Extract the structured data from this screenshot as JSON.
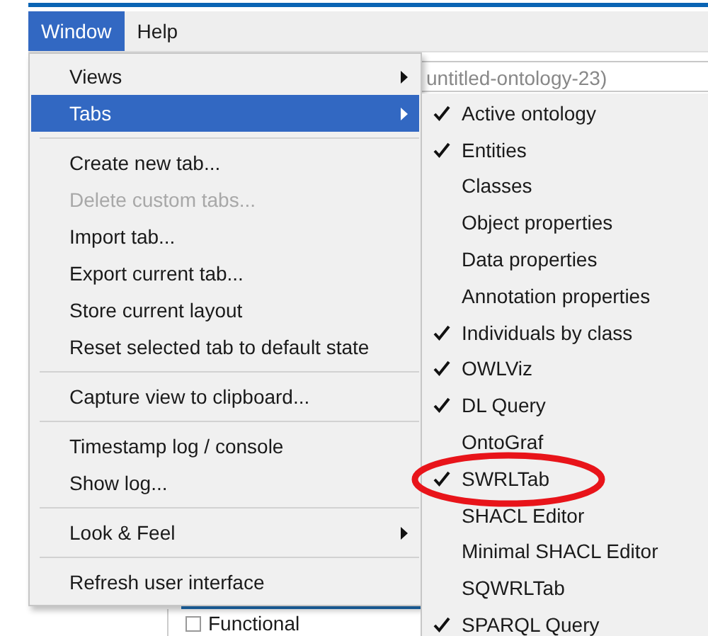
{
  "menubar": [
    {
      "label": "Window",
      "selected": true
    },
    {
      "label": "Help",
      "selected": false
    }
  ],
  "background": {
    "field_text": "untitled-ontology-23)",
    "checkbox_label": "Functional",
    "checkbox_checked": false
  },
  "window_menu": [
    {
      "kind": "item",
      "label": "Views",
      "submenu": true,
      "disabled": false,
      "selected": false
    },
    {
      "kind": "item",
      "label": "Tabs",
      "submenu": true,
      "disabled": false,
      "selected": true
    },
    {
      "kind": "separator"
    },
    {
      "kind": "item",
      "label": "Create new tab...",
      "submenu": false,
      "disabled": false,
      "selected": false
    },
    {
      "kind": "item",
      "label": "Delete custom tabs...",
      "submenu": false,
      "disabled": true,
      "selected": false
    },
    {
      "kind": "item",
      "label": "Import tab...",
      "submenu": false,
      "disabled": false,
      "selected": false
    },
    {
      "kind": "item",
      "label": "Export current tab...",
      "submenu": false,
      "disabled": false,
      "selected": false
    },
    {
      "kind": "item",
      "label": "Store current layout",
      "submenu": false,
      "disabled": false,
      "selected": false
    },
    {
      "kind": "item",
      "label": "Reset selected tab to default state",
      "submenu": false,
      "disabled": false,
      "selected": false
    },
    {
      "kind": "separator"
    },
    {
      "kind": "item",
      "label": "Capture view to clipboard...",
      "submenu": false,
      "disabled": false,
      "selected": false
    },
    {
      "kind": "separator"
    },
    {
      "kind": "item",
      "label": "Timestamp log / console",
      "submenu": false,
      "disabled": false,
      "selected": false
    },
    {
      "kind": "item",
      "label": "Show log...",
      "submenu": false,
      "disabled": false,
      "selected": false
    },
    {
      "kind": "separator"
    },
    {
      "kind": "item",
      "label": "Look & Feel",
      "submenu": true,
      "disabled": false,
      "selected": false
    },
    {
      "kind": "separator"
    },
    {
      "kind": "item",
      "label": "Refresh user interface",
      "submenu": false,
      "disabled": false,
      "selected": false
    }
  ],
  "tabs_submenu": [
    {
      "label": "Active ontology",
      "checked": true
    },
    {
      "label": "Entities",
      "checked": true
    },
    {
      "label": "Classes",
      "checked": false
    },
    {
      "label": "Object properties",
      "checked": false
    },
    {
      "label": "Data properties",
      "checked": false
    },
    {
      "label": "Annotation properties",
      "checked": false
    },
    {
      "label": "Individuals by class",
      "checked": true
    },
    {
      "label": "OWLViz",
      "checked": true
    },
    {
      "label": "DL Query",
      "checked": true
    },
    {
      "label": "OntoGraf",
      "checked": false
    },
    {
      "label": "SWRLTab",
      "checked": true
    },
    {
      "label": "SHACL Editor",
      "checked": false
    },
    {
      "label": "Minimal SHACL Editor",
      "checked": false
    },
    {
      "label": "SQWRLTab",
      "checked": false
    },
    {
      "label": "SPARQL Query",
      "checked": true
    }
  ]
}
